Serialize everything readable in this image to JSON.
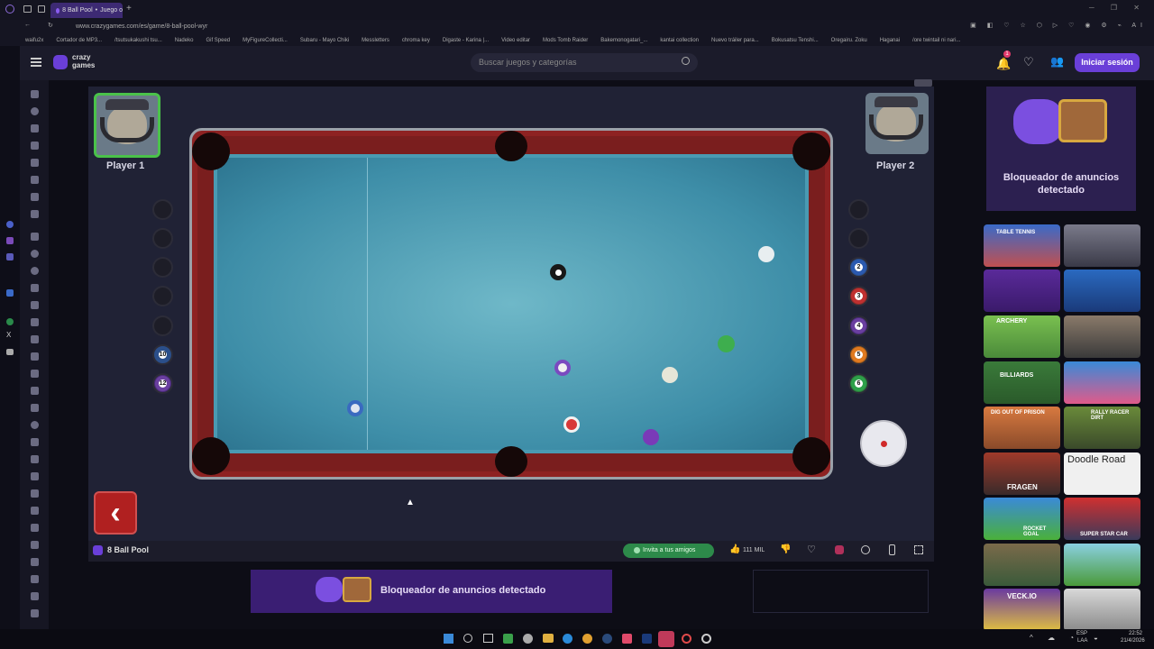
{
  "browser": {
    "tab_title": "8 Ball Pool",
    "tab_subtitle": "Juego o",
    "url": "www.crazygames.com/es/game/8-ball-pool-wyr",
    "bookmarks": [
      "waifu2x",
      "Cortador de MP3...",
      "/tsutsukakushi tsu...",
      "Nadeko",
      "Gif Speed",
      "MyFigureCollecti...",
      "Subaru - Mayo Chiki",
      "Messletters",
      "chroma key",
      "Digaste - Karina |...",
      "Video editar",
      "Mods Tomb Raider",
      "Bakemonogatari_...",
      "kantai collection",
      "Nuevo tráiler para...",
      "Bokusatsu Tenshi...",
      "Oregairu. Zoku",
      "Haganai",
      "/ore twintail ni nari..."
    ]
  },
  "site": {
    "logo_line1": "crazy",
    "logo_line2": "games",
    "search_placeholder": "Buscar juegos y categorías",
    "login_label": "Iniciar sesión",
    "notification_count": "1"
  },
  "game": {
    "title": "8 Ball Pool",
    "player1": "Player 1",
    "player2": "Player 2",
    "p1_balls": [
      "",
      "",
      "",
      "",
      "",
      "10",
      "12"
    ],
    "p2_balls": [
      "",
      "",
      "2",
      "3",
      "4",
      "5",
      "6"
    ],
    "invite_label": "Invita a tus amigos",
    "likes": "111 MIL"
  },
  "ads": {
    "right_text": "Bloqueador de anuncios detectado",
    "bottom_text": "Bloqueador de anuncios detectado"
  },
  "thumbnails": [
    "TABLE TENNIS",
    "",
    "",
    "",
    "ARCHERY",
    "",
    "BILLIARDS",
    "",
    "DIG OUT OF PRISON",
    "RALLY RACER DIRT",
    "FRAGEN",
    "Doodle Road",
    "ROCKET GOAL",
    "SUPER STAR CAR",
    "",
    "",
    "VECK.IO",
    ""
  ],
  "taskbar": {
    "lang": "ESP",
    "lang2": "LAA",
    "time": "22:52",
    "date": "21/4/2026"
  }
}
